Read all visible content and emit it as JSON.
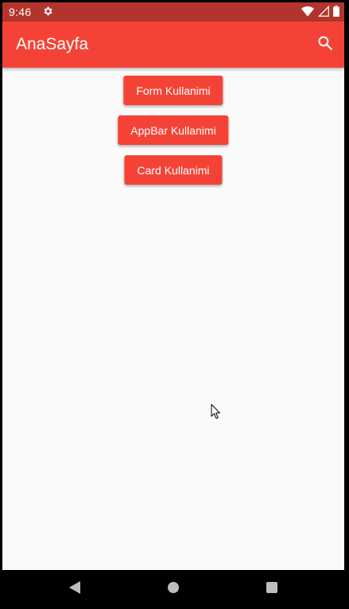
{
  "status_bar": {
    "time": "9:46",
    "icons": [
      "settings-gear-icon",
      "wifi-icon",
      "cell-signal-icon",
      "battery-icon"
    ]
  },
  "app_bar": {
    "title": "AnaSayfa",
    "action_icon": "search-icon"
  },
  "buttons": {
    "form_label": "Form Kullanimi",
    "appbar_label": "AppBar Kullanimi",
    "card_label": "Card Kullanimi"
  },
  "nav_bar": {
    "icons": [
      "back-icon",
      "home-icon",
      "recents-icon"
    ]
  },
  "colors": {
    "status_bar": "#b3342c",
    "app_bar": "#f44336",
    "button": "#f44336",
    "background": "#fafafa"
  }
}
